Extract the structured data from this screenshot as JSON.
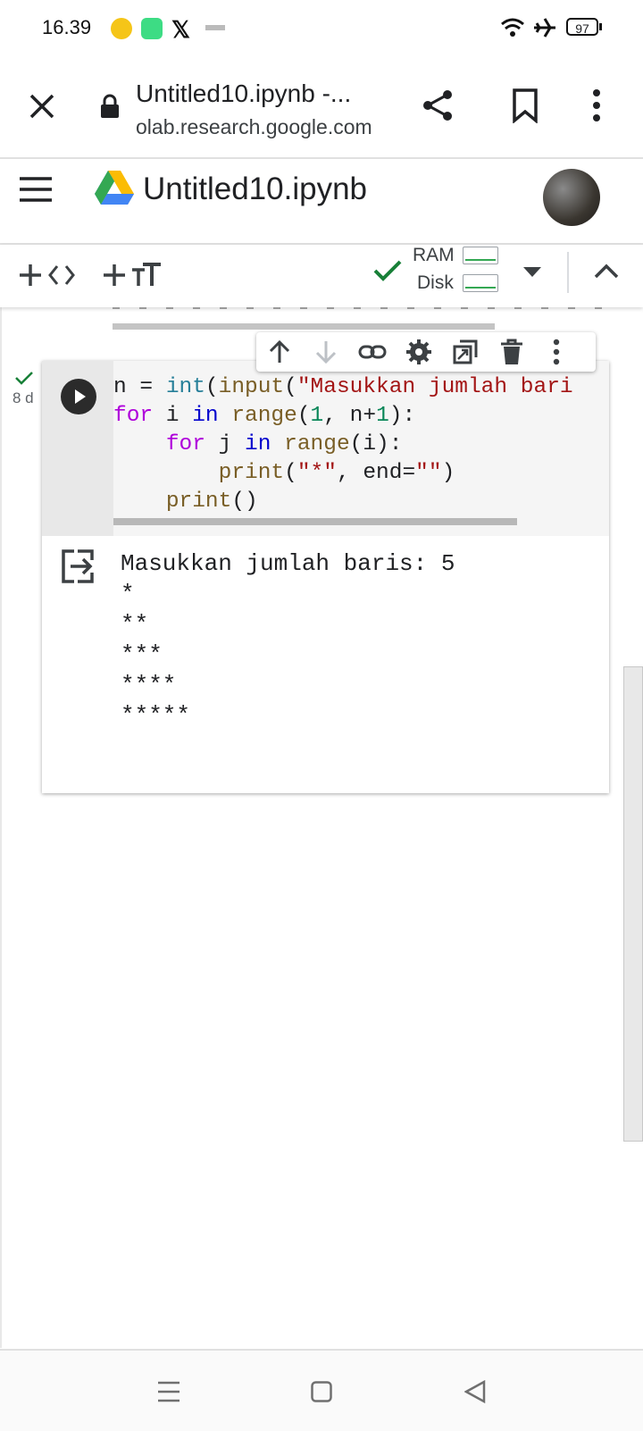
{
  "status_bar": {
    "time": "16.39",
    "battery": "97"
  },
  "browser": {
    "page_title": "Untitled10.ipynb -...",
    "domain": "olab.research.google.com"
  },
  "colab": {
    "notebook_title": "Untitled10.ipynb"
  },
  "toolbar": {
    "ram_label": "RAM",
    "disk_label": "Disk"
  },
  "cell": {
    "exec_time": "8 d",
    "code_lines": [
      "n = int(input(\"Masukkan jumlah bari",
      "for i in range(1, n+1):",
      "    for j in range(i):",
      "        print(\"*\", end=\"\")",
      "    print()"
    ],
    "output_lines": [
      "Masukkan jumlah baris: 5",
      "*",
      "**",
      "***",
      "****",
      "*****"
    ]
  },
  "colors": {
    "accent_green": "#188038",
    "keyword": "#af00db",
    "string": "#a31515",
    "number": "#098658"
  }
}
